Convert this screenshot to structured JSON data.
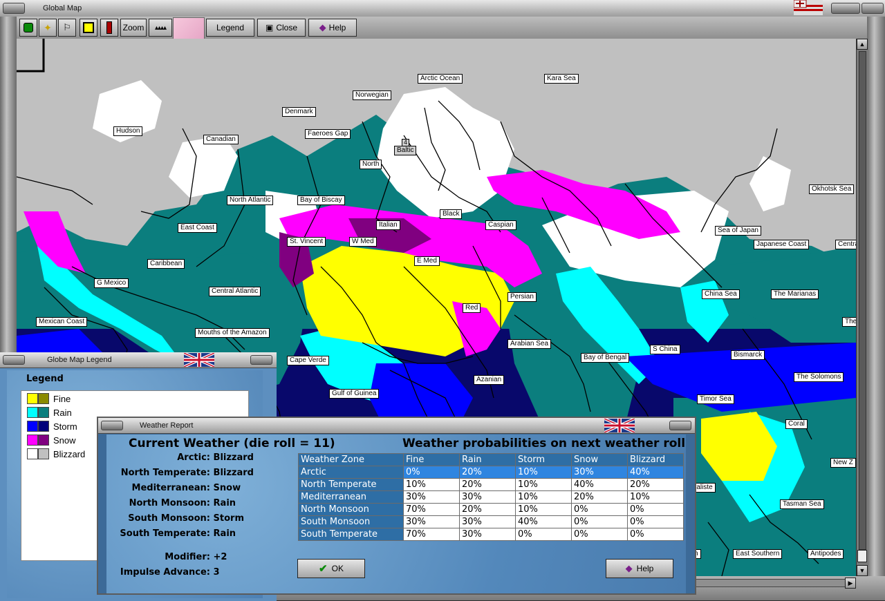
{
  "main_window": {
    "title": "Global Map",
    "toolbar": {
      "zoom_label": "Zoom",
      "legend_label": "Legend",
      "close_label": "Close",
      "help_label": "Help"
    }
  },
  "map_labels": [
    "Arctic Ocean",
    "Kara Sea",
    "Norwegian",
    "Denmark",
    "Hudson",
    "Canadian",
    "Faeroes Gap",
    "Baltic",
    "North",
    "North Atlantic",
    "Bay of Biscay",
    "Black",
    "Caspian",
    "Italian",
    "Okhotsk Sea",
    "Sea of Japan",
    "East Coast",
    "St. Vincent",
    "W Med",
    "Japanese Coast",
    "Central P",
    "Caribbean",
    "E Med",
    "G Mexico",
    "Central Atlantic",
    "Persian",
    "China Sea",
    "The Marianas",
    "Red",
    "Mexican Coast",
    "The",
    "Mouths of the Amazon",
    "Arabian Sea",
    "S China",
    "Bismarck",
    "Bay of Bengal",
    "Cape Verde",
    "Azanian",
    "The Solomons",
    "Gulf of Guinea",
    "Timor Sea",
    "Coral",
    "New Z",
    "raliste",
    "Tasman Sea",
    "East Southern",
    "Antipodes",
    "n"
  ],
  "baltic_badge": "4",
  "legend_window": {
    "title": "Globe Map Legend",
    "heading": "Legend",
    "items": [
      {
        "label": "Fine",
        "color": "#ffff00",
        "color2": "#8a8a00"
      },
      {
        "label": "Rain",
        "color": "#00ffff",
        "color2": "#0b7e7e"
      },
      {
        "label": "Storm",
        "color": "#0000ff",
        "color2": "#00007a"
      },
      {
        "label": "Snow",
        "color": "#ff00ff",
        "color2": "#800080"
      },
      {
        "label": "Blizzard",
        "color": "#ffffff",
        "color2": "#c0c0c0"
      }
    ]
  },
  "weather_report": {
    "title": "Weather Report",
    "current_heading": "Current Weather (die roll = 11)",
    "prob_heading": "Weather probabilities on next weather roll",
    "current": [
      {
        "zone": "Arctic:",
        "value": "Blizzard"
      },
      {
        "zone": "North Temperate:",
        "value": "Blizzard"
      },
      {
        "zone": "Mediterranean:",
        "value": "Snow"
      },
      {
        "zone": "North Monsoon:",
        "value": "Rain"
      },
      {
        "zone": "South Monsoon:",
        "value": "Storm"
      },
      {
        "zone": "South Temperate:",
        "value": "Rain"
      }
    ],
    "modifier_label": "Modifier:",
    "modifier_value": "+2",
    "impulse_label": "Impulse Advance:",
    "impulse_value": "3",
    "table": {
      "headers": [
        "Weather Zone",
        "Fine",
        "Rain",
        "Storm",
        "Snow",
        "Blizzard"
      ],
      "rows": [
        [
          "Arctic",
          "0%",
          "20%",
          "10%",
          "30%",
          "40%"
        ],
        [
          "North Temperate",
          "10%",
          "20%",
          "10%",
          "40%",
          "20%"
        ],
        [
          "Mediterranean",
          "30%",
          "30%",
          "10%",
          "20%",
          "10%"
        ],
        [
          "North Monsoon",
          "70%",
          "20%",
          "10%",
          "0%",
          "0%"
        ],
        [
          "South Monsoon",
          "30%",
          "30%",
          "40%",
          "0%",
          "0%"
        ],
        [
          "South Temperate",
          "70%",
          "30%",
          "0%",
          "0%",
          "0%"
        ]
      ]
    },
    "ok_label": "OK",
    "help_label": "Help"
  }
}
